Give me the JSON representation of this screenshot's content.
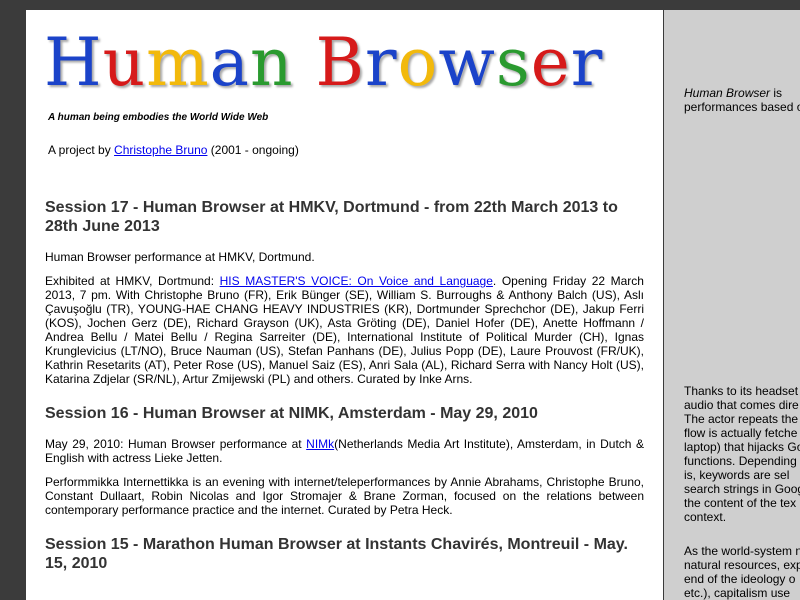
{
  "header": {
    "logo": [
      {
        "ch": "H",
        "color": "#1b43c9"
      },
      {
        "ch": "u",
        "color": "#d61a1a"
      },
      {
        "ch": "m",
        "color": "#f2b90c"
      },
      {
        "ch": "a",
        "color": "#1b43c9"
      },
      {
        "ch": "n",
        "color": "#2a9a2f"
      },
      {
        "ch": " ",
        "color": "#000000"
      },
      {
        "ch": "B",
        "color": "#d61a1a"
      },
      {
        "ch": "r",
        "color": "#1b43c9"
      },
      {
        "ch": "o",
        "color": "#f2b90c"
      },
      {
        "ch": "w",
        "color": "#1b43c9"
      },
      {
        "ch": "s",
        "color": "#2a9a2f"
      },
      {
        "ch": "e",
        "color": "#d61a1a"
      },
      {
        "ch": "r",
        "color": "#1b43c9"
      }
    ],
    "tagline": "A human being embodies the World Wide Web",
    "project_prefix": "A project by ",
    "project_author": "Christophe Bruno",
    "project_suffix": " (2001 - ongoing)"
  },
  "sessions": [
    {
      "title": "Session 17 - Human Browser at HMKV, Dortmund - from 22th March 2013 to 28th June 2013",
      "p1": "Human Browser performance at HMKV, Dortmund.",
      "p2_prefix": "Exhibited at HMKV, Dortmund: ",
      "p2_link": "HIS MASTER'S VOICE: On Voice and Language",
      "p2_suffix": ". Opening Friday 22 March 2013, 7 pm. With Christophe Bruno (FR), Erik Bünger (SE), William S. Burroughs & Anthony Balch (US), Aslı Çavuşoğlu (TR), YOUNG-HAE CHANG HEAVY INDUSTRIES (KR), Dortmunder Sprechchor (DE), Jakup Ferri (KOS), Jochen Gerz (DE), Richard Grayson (UK), Asta Gröting (DE), Daniel Hofer (DE), Anette Hoffmann / Andrea Bellu / Matei Bellu / Regina Sarreiter (DE), International Institute of Political Murder (CH), Ignas Krunglevicius (LT/NO), Bruce Nauman (US), Stefan Panhans (DE), Julius Popp (DE), Laure Prouvost (FR/UK), Kathrin Resetarits (AT), Peter Rose (US), Manuel Saiz (ES), Anri Sala (AL), Richard Serra with Nancy Holt (US), Katarina Zdjelar (SR/NL), Artur Zmijewski (PL) and others. Curated by Inke Arns."
    },
    {
      "title": "Session 16 - Human Browser at NIMK, Amsterdam - May 29, 2010",
      "p1_prefix": "May 29, 2010: Human Browser performance at ",
      "p1_link": "NIMk",
      "p1_suffix": "(Netherlands Media Art Institute), Amsterdam, in Dutch & English with actress Lieke Jetten.",
      "p2": "Performmikka Internettikka is an evening with internet/teleperformances by Annie Abrahams, Christophe Bruno, Constant Dullaart, Robin Nicolas and Igor Stromajer & Brane Zorman, focused on the relations between contemporary performance practice and the internet. Curated by Petra Heck."
    },
    {
      "title": "Session 15 - Marathon Human Browser at Instants Chavirés, Montreuil - May. 15, 2010"
    }
  ],
  "sidebar": {
    "intro_em": "Human Browser",
    "intro_rest_1": " is",
    "intro_line_2": "performances based o",
    "block2": [
      "Thanks to its headset",
      "audio that comes dire",
      "The actor repeats the",
      "flow is actually fetche",
      "laptop) that hijacks Go",
      "functions. Depending",
      "is, keywords are sel",
      "search strings in Goog",
      "the content of the tex",
      "context."
    ],
    "block3": [
      "As the world-system n",
      "natural resources, exp",
      "end of the ideology o",
      "etc.), capitalism use"
    ]
  }
}
